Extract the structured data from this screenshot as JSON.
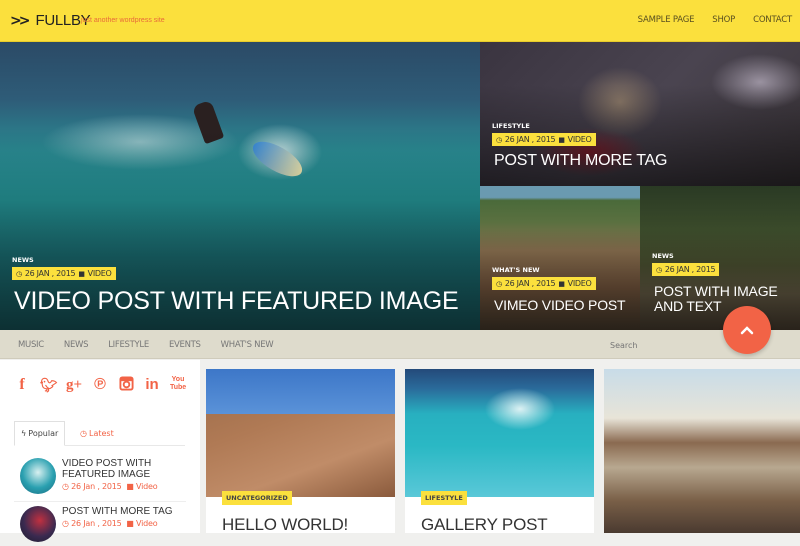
{
  "header": {
    "logo_mark": ">>",
    "site_title": "FULLBY",
    "tagline": "just another wordpress site",
    "nav": [
      "SAMPLE PAGE",
      "SHOP",
      "CONTACT"
    ]
  },
  "featured": {
    "main": {
      "category": "NEWS",
      "date": "26 JAN , 2015",
      "format": "VIDEO",
      "title": "VIDEO POST WITH FEATURED IMAGE"
    },
    "top_right": {
      "category": "LIFESTYLE",
      "date": "26 JAN , 2015",
      "format": "VIDEO",
      "title": "POST WITH MORE TAG"
    },
    "bottom_left": {
      "category": "WHAT'S NEW",
      "date": "26 JAN , 2015",
      "format": "VIDEO",
      "title": "VIMEO VIDEO POST"
    },
    "bottom_right": {
      "category": "NEWS",
      "date": "26 JAN , 2015",
      "title_line1": "POST WITH IMAGE",
      "title_line2": "AND TEXT"
    }
  },
  "category_nav": {
    "items": [
      "MUSIC",
      "NEWS",
      "LIFESTYLE",
      "EVENTS",
      "WHAT'S NEW"
    ],
    "search_placeholder": "Search"
  },
  "sidebar": {
    "social": [
      "facebook",
      "twitter",
      "google-plus",
      "pinterest",
      "instagram",
      "linkedin",
      "youtube"
    ],
    "tabs": {
      "popular": "Popular",
      "latest": "Latest"
    },
    "posts": [
      {
        "title_line1": "VIDEO POST WITH",
        "title_line2": "FEATURED IMAGE",
        "date": "26 Jan , 2015",
        "format": "Video"
      },
      {
        "title_line1": "POST WITH MORE TAG",
        "date": "26 Jan , 2015",
        "format": "Video"
      }
    ]
  },
  "cards": [
    {
      "category": "UNCATEGORIZED",
      "title": "HELLO WORLD!"
    },
    {
      "category": "LIFESTYLE",
      "title": "GALLERY POST"
    }
  ],
  "colors": {
    "accent_yellow": "#fbe03d",
    "accent_orange": "#f26346",
    "nav_bg": "#dedbcc"
  }
}
